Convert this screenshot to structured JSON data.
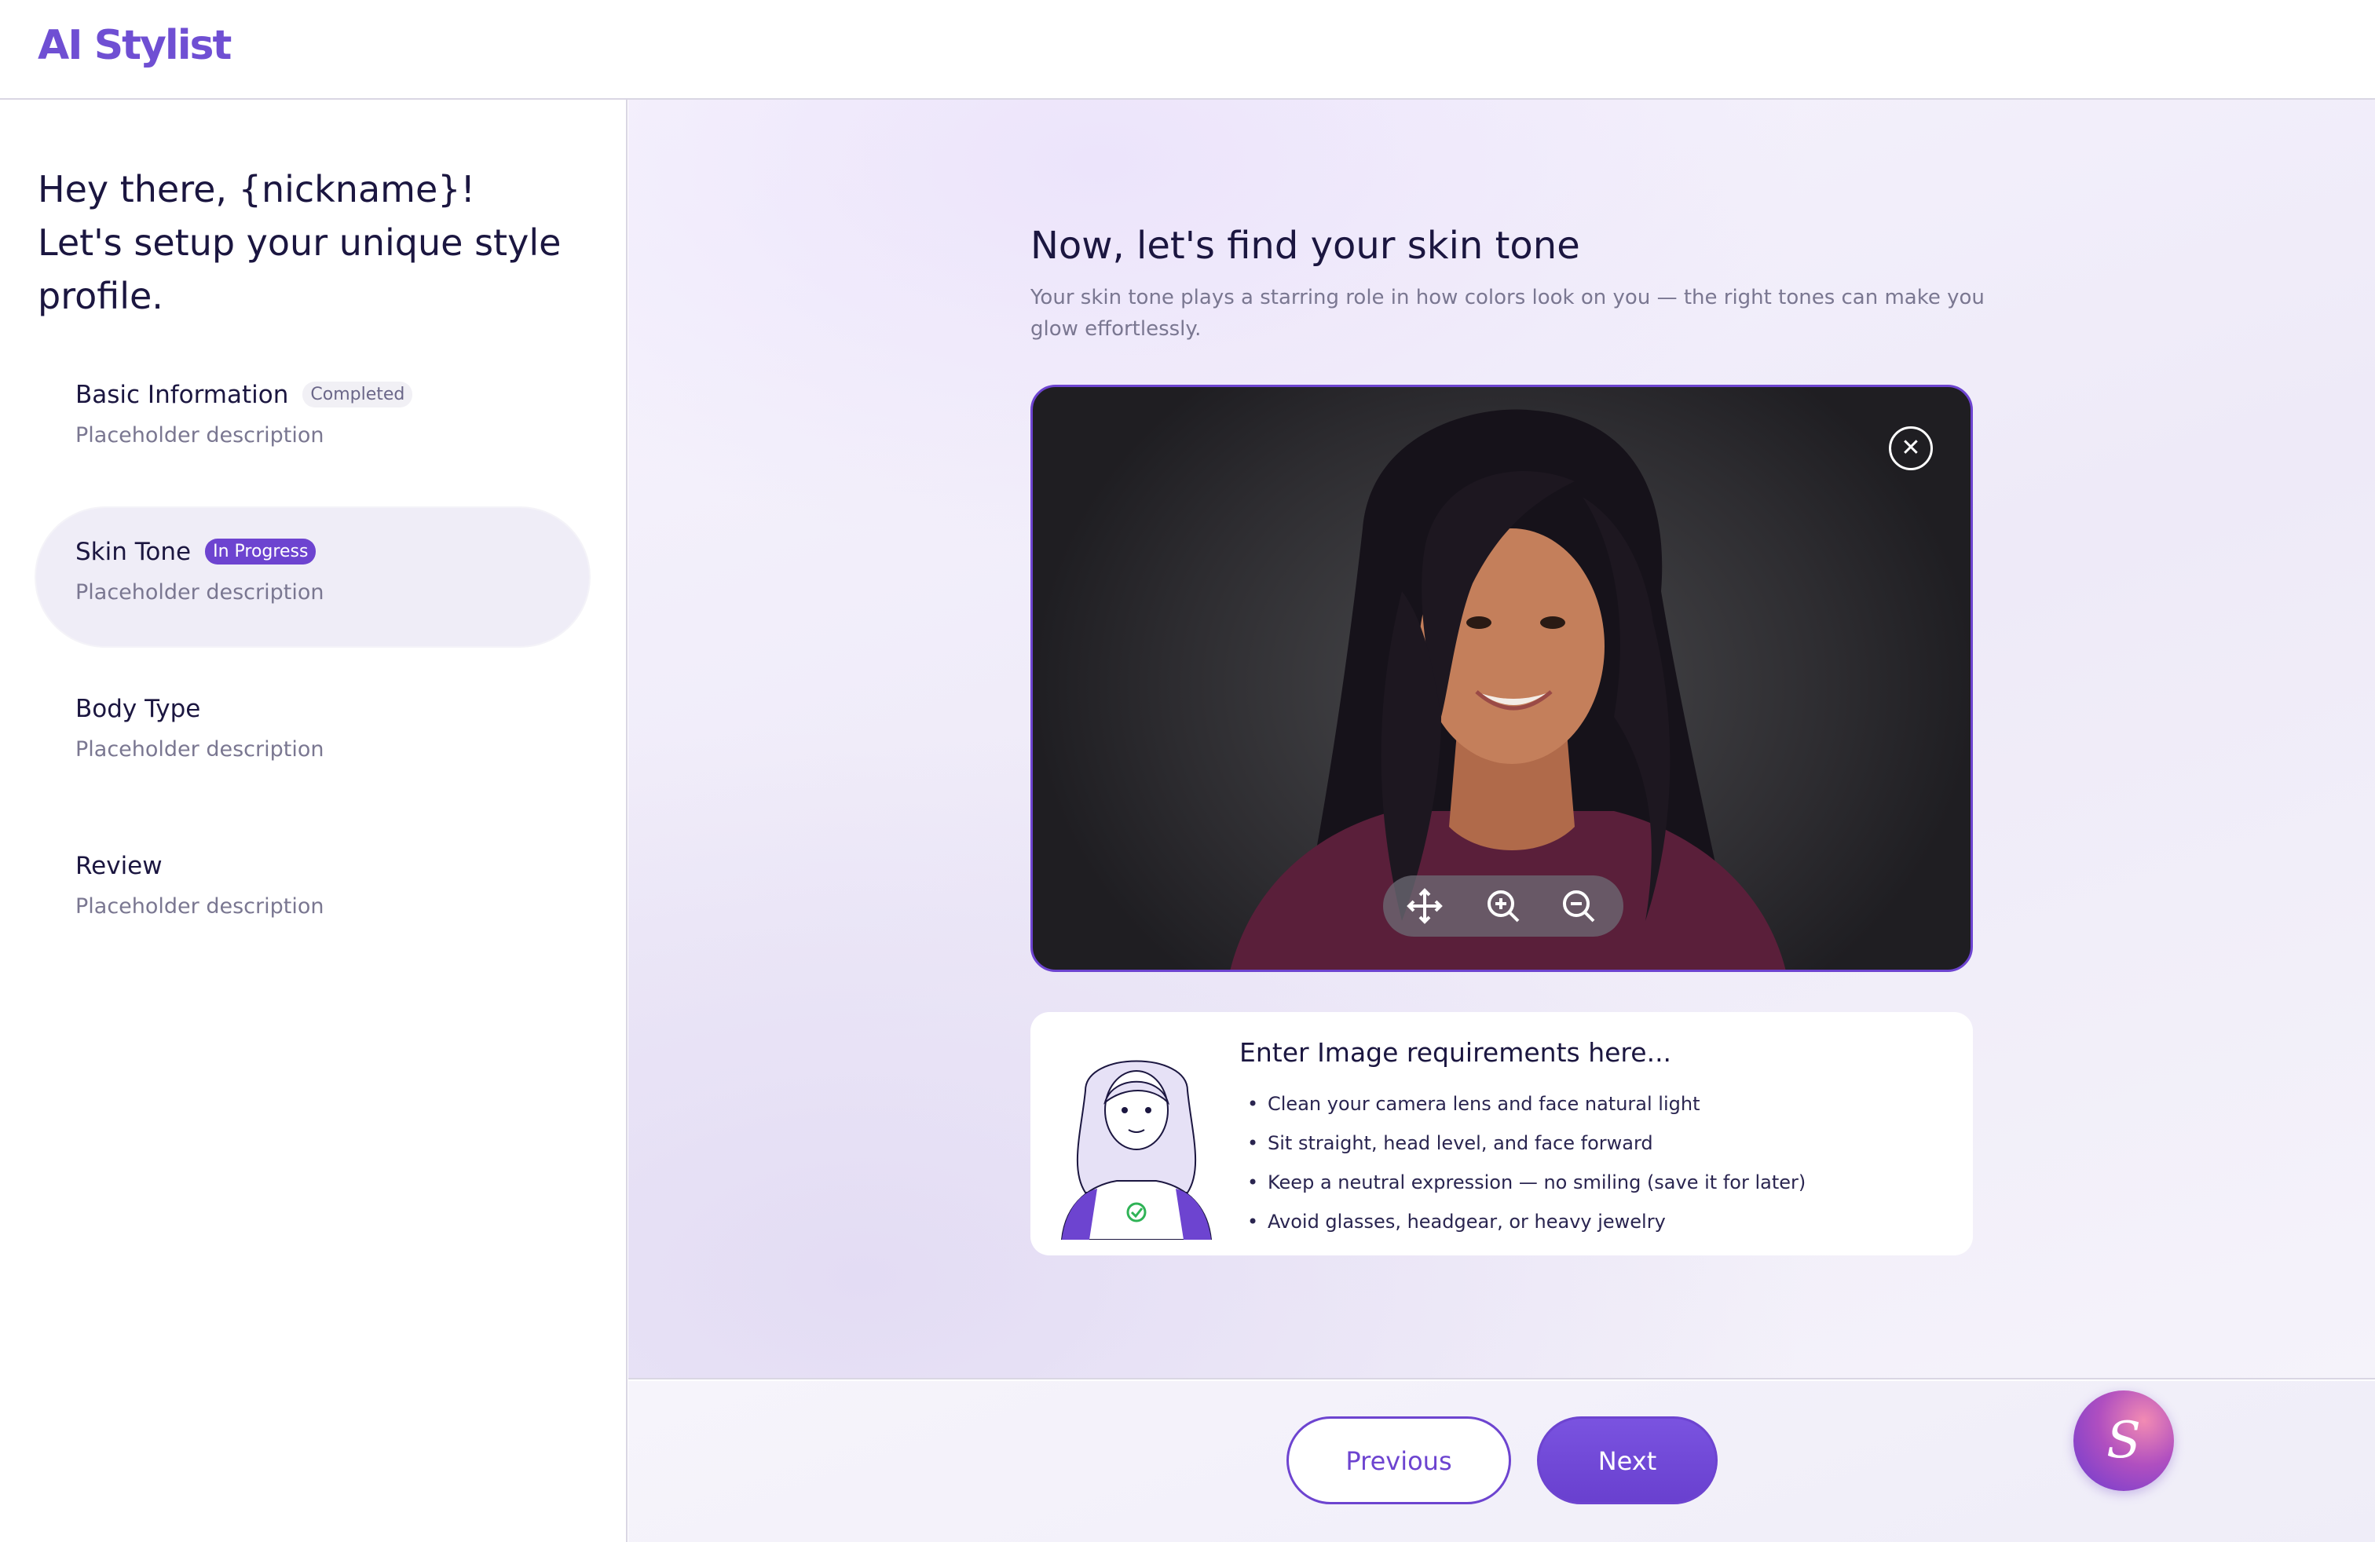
{
  "app": {
    "logo": "AI Stylist"
  },
  "sidebar": {
    "greeting_line1": "Hey there, {nickname}!",
    "greeting_line2": "Let's setup your unique style profile.",
    "steps": [
      {
        "title": "Basic Information",
        "badge": "Completed",
        "description": "Placeholder description"
      },
      {
        "title": "Skin Tone",
        "badge": "In Progress",
        "description": "Placeholder description"
      },
      {
        "title": "Body Type",
        "badge": "",
        "description": "Placeholder description"
      },
      {
        "title": "Review",
        "badge": "",
        "description": "Placeholder description"
      }
    ]
  },
  "main": {
    "title": "Now, let's find your skin tone",
    "subtitle": "Your skin tone plays a starring role in how colors look on you — the right tones can make you glow effortlessly.",
    "photo": {
      "toolbar_icons": [
        "move-icon",
        "zoom-in-icon",
        "zoom-out-icon"
      ],
      "close_icon": "close-icon"
    },
    "requirements": {
      "title": "Enter Image requirements here...",
      "items": [
        "Clean your camera lens and face natural light",
        "Sit straight, head level, and face forward",
        "Keep a neutral expression — no smiling (save it for later)",
        "Avoid glasses, headgear, or heavy jewelry"
      ]
    }
  },
  "footer": {
    "previous_label": "Previous",
    "next_label": "Next",
    "assistant_letter": "S"
  },
  "colors": {
    "accent": "#6d44d0",
    "text": "#1b1640",
    "muted": "#7a7791"
  }
}
